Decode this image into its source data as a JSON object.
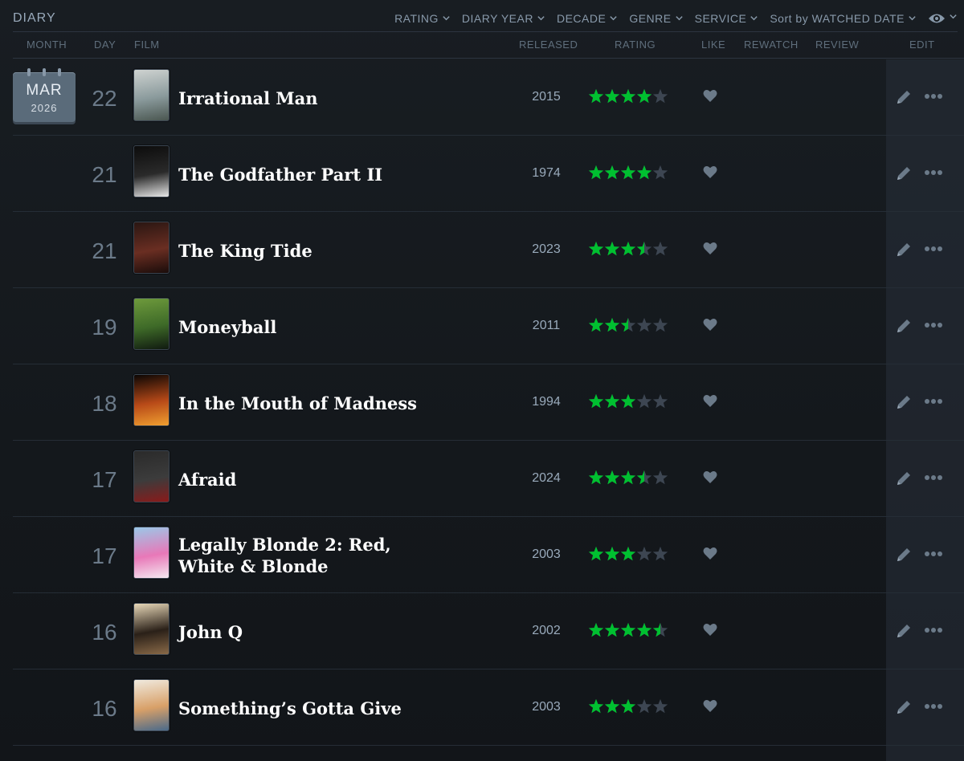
{
  "header": {
    "title": "DIARY",
    "filters": [
      "RATING",
      "DIARY YEAR",
      "DECADE",
      "GENRE",
      "SERVICE",
      "Sort by WATCHED DATE"
    ]
  },
  "columns": {
    "month": "MONTH",
    "day": "DAY",
    "film": "FILM",
    "released": "RELEASED",
    "rating": "RATING",
    "like": "LIKE",
    "rewatch": "REWATCH",
    "review": "REVIEW",
    "edit": "EDIT"
  },
  "calendar": {
    "month": "MAR",
    "year": "2026"
  },
  "colors": {
    "star_on": "#00c030",
    "star_off": "#3d4652",
    "accent": "#00e054"
  },
  "icons": [
    "chevron-down-icon",
    "eye-icon",
    "star-icon",
    "heart-icon",
    "pencil-icon",
    "more-icon"
  ],
  "entries": [
    {
      "day": "22",
      "film": "Irrational Man",
      "released": "2015",
      "rating": 4,
      "poster": [
        "#cfd3d1",
        "#8a9a9c",
        "#4a5650"
      ]
    },
    {
      "day": "21",
      "film": "The Godfather Part II",
      "released": "1974",
      "rating": 4,
      "poster": [
        "#0c0c0c",
        "#2a2a2a",
        "#e8e8e8"
      ]
    },
    {
      "day": "21",
      "film": "The King Tide",
      "released": "2023",
      "rating": 3.5,
      "poster": [
        "#2a1612",
        "#6a2e22",
        "#1a0c0a"
      ]
    },
    {
      "day": "19",
      "film": "Moneyball",
      "released": "2011",
      "rating": 2.5,
      "poster": [
        "#6e9a3c",
        "#3e6a28",
        "#101a10"
      ]
    },
    {
      "day": "18",
      "film": "In the Mouth of Madness",
      "released": "1994",
      "rating": 3,
      "poster": [
        "#0a0604",
        "#b84a18",
        "#f0a030"
      ]
    },
    {
      "day": "17",
      "film": "Afraid",
      "released": "2024",
      "rating": 3.5,
      "poster": [
        "#2a2a2a",
        "#3c3c3c",
        "#8a1a1a"
      ]
    },
    {
      "day": "17",
      "film": "Legally Blonde 2: Red, White & Blonde",
      "released": "2003",
      "rating": 3,
      "poster": [
        "#9ac8e8",
        "#e878b8",
        "#f4e8f0"
      ]
    },
    {
      "day": "16",
      "film": "John Q",
      "released": "2002",
      "rating": 4.5,
      "poster": [
        "#e8d8b8",
        "#2a2018",
        "#8a6a48"
      ]
    },
    {
      "day": "16",
      "film": "Something’s Gotta Give",
      "released": "2003",
      "rating": 3,
      "poster": [
        "#f0eadf",
        "#d8a068",
        "#4a6a8a"
      ]
    }
  ]
}
